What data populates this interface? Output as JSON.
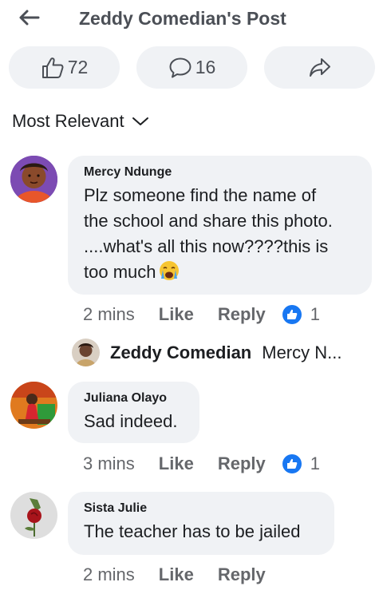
{
  "header": {
    "title": "Zeddy Comedian's Post",
    "back_icon": "arrow-left-icon"
  },
  "actions": {
    "like_count": "72",
    "comment_count": "16",
    "like_icon": "thumbs-up-icon",
    "comment_icon": "comment-bubble-icon",
    "share_icon": "share-arrow-icon"
  },
  "sort": {
    "label": "Most Relevant",
    "icon": "chevron-down-icon"
  },
  "colors": {
    "bubble": "#f0f2f5",
    "like_blue": "#1877f2",
    "muted_text": "#65676b"
  },
  "comments": [
    {
      "author": "Mercy Ndunge",
      "lines": [
        "Plz someone find the name of",
        "the school and share this photo.",
        "....what's all this now????this is",
        "too much"
      ],
      "emoji": "crying-face-emoji",
      "time": "2 mins",
      "like": "Like",
      "reply": "Reply",
      "reactions": "1"
    },
    {
      "author": "Juliana Olayo",
      "text": "Sad indeed.",
      "time": "3 mins",
      "like": "Like",
      "reply": "Reply",
      "reactions": "1"
    },
    {
      "author": "Sista Julie",
      "text": "The teacher has to be jailed",
      "time": "2 mins",
      "like": "Like",
      "reply": "Reply"
    }
  ],
  "reply_preview": {
    "author": "Zeddy Comedian",
    "text": "Mercy N..."
  }
}
